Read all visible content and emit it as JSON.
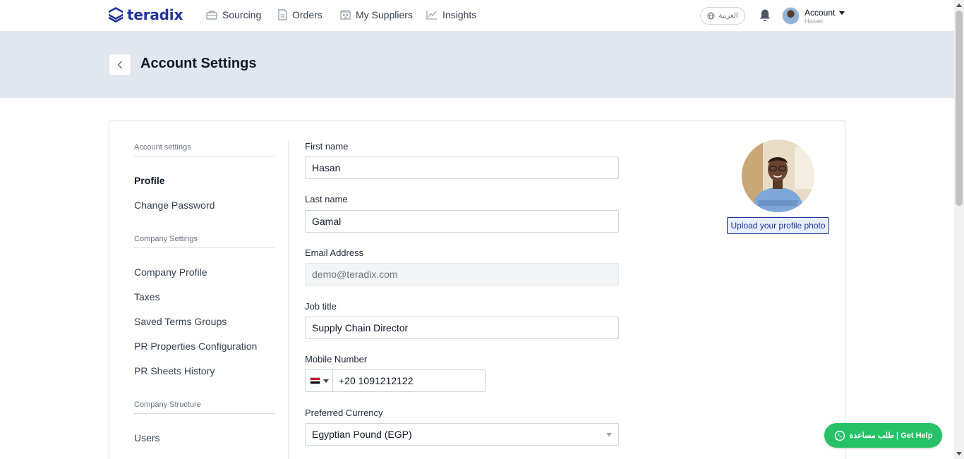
{
  "brand": {
    "name": "teradix",
    "color": "#21349b"
  },
  "nav": {
    "items": [
      {
        "label": "Sourcing",
        "icon": "sourcing-icon"
      },
      {
        "label": "Orders",
        "icon": "orders-icon"
      },
      {
        "label": "My Suppliers",
        "icon": "suppliers-icon"
      },
      {
        "label": "Insights",
        "icon": "insights-icon"
      }
    ],
    "language": "العربية",
    "account": {
      "label": "Account",
      "user": "Hasan"
    }
  },
  "header": {
    "title": "Account Settings"
  },
  "sidebar": {
    "sections": [
      {
        "heading": "Account settings",
        "items": [
          "Profile",
          "Change Password"
        ]
      },
      {
        "heading": "Company Settings",
        "items": [
          "Company Profile",
          "Taxes",
          "Saved Terms Groups",
          "PR Properties Configuration",
          "PR Sheets History"
        ]
      },
      {
        "heading": "Company Structure",
        "items": [
          "Users"
        ]
      }
    ],
    "active": "Profile"
  },
  "form": {
    "first_name": {
      "label": "First name",
      "value": "Hasan"
    },
    "last_name": {
      "label": "Last name",
      "value": "Gamal"
    },
    "email": {
      "label": "Email Address",
      "placeholder": "demo@teradix.com"
    },
    "job_title": {
      "label": "Job title",
      "value": "Supply Chain Director"
    },
    "mobile": {
      "label": "Mobile Number",
      "country": "Egypt",
      "value": "+20 1091212122"
    },
    "currency": {
      "label": "Preferred Currency",
      "value": "Egyptian Pound (EGP)"
    }
  },
  "profile": {
    "upload_label": "Upload your profile photo"
  },
  "help": {
    "label": "طلب مساعدة | Get Help",
    "color": "#27c167"
  }
}
